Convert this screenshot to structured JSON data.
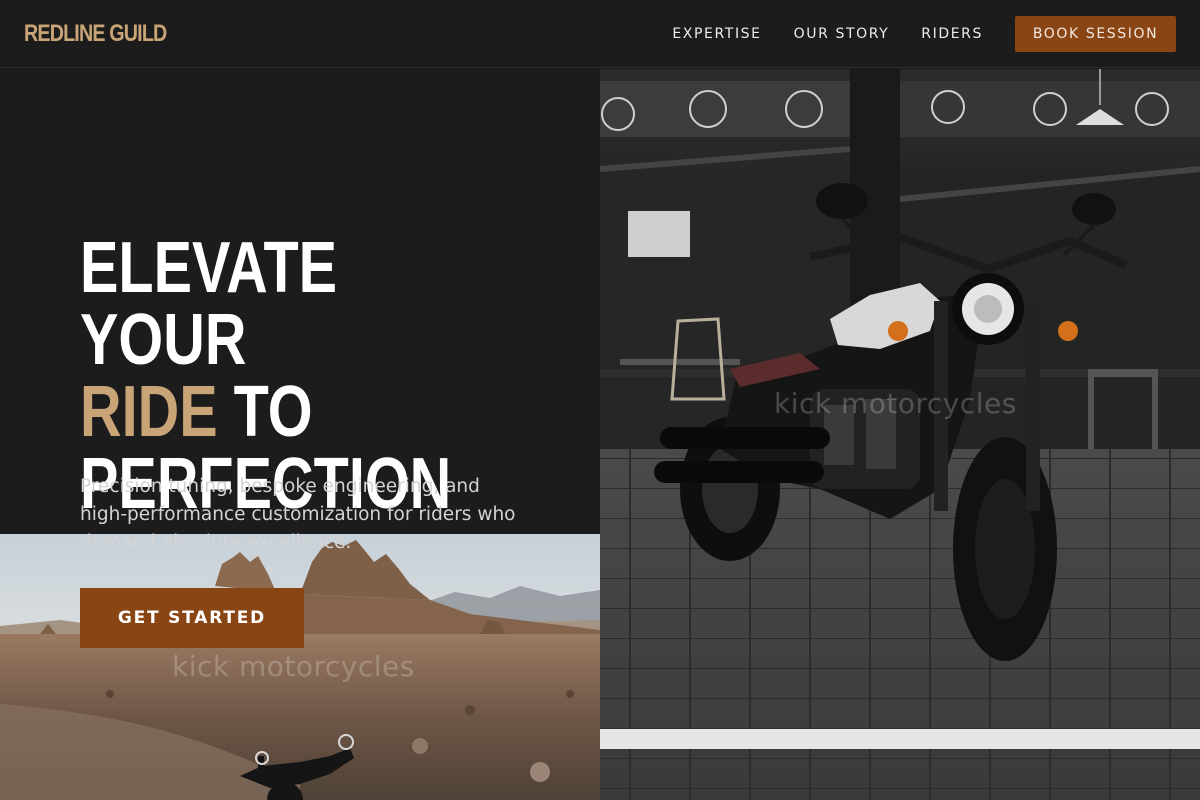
{
  "nav": {
    "brand": "REDLINE GUILD",
    "links": [
      "EXPERTISE",
      "OUR STORY",
      "RIDERS"
    ],
    "cta": "BOOK SESSION"
  },
  "hero": {
    "headline_line1": "ELEVATE YOUR",
    "headline_accent": "RIDE",
    "headline_line2_rest": " TO",
    "headline_line3": "PERFECTION",
    "subtext": "Precision tuning, bespoke engineering, and high-performance customization for riders who demand absolute excellence.",
    "cta": "GET STARTED"
  },
  "images": {
    "desert_watermark": "kick motorcycles",
    "bike_watermark": "kick motorcycles"
  },
  "colors": {
    "accent": "#c9a477",
    "button": "#8a4515",
    "background": "#1c1c1c"
  }
}
